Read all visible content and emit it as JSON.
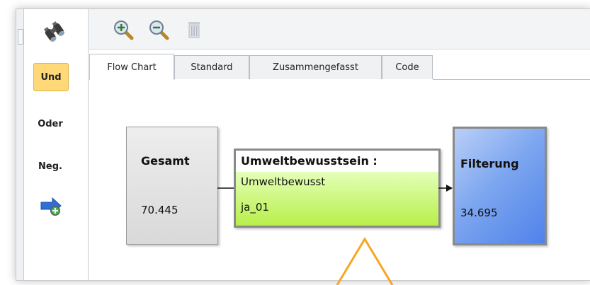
{
  "sidebar": {
    "buttons": [
      {
        "label": "Und",
        "active": true
      },
      {
        "label": "Oder"
      },
      {
        "label": "Neg."
      }
    ],
    "icons": [
      "binoculars-icon",
      "add-arrow-icon"
    ]
  },
  "toolbar": {
    "icons": [
      "zoom-in-icon",
      "zoom-out-icon",
      "trash-icon"
    ]
  },
  "tabs": [
    {
      "label": "Flow Chart",
      "active": true
    },
    {
      "label": "Standard"
    },
    {
      "label": "Zusammengefasst"
    },
    {
      "label": "Code"
    }
  ],
  "flow": {
    "gesamt": {
      "title": "Gesamt",
      "value": "70.445"
    },
    "umwelt": {
      "title": "Umweltbewusstsein :",
      "line1": "Umweltbewusst",
      "line2": "ja_01"
    },
    "filter": {
      "title": "Filterung",
      "value": "34.695"
    }
  },
  "colors": {
    "active_button": "#ffd978",
    "condition_fill": "#b8ef4a",
    "result_fill": "#4f82ea",
    "annotation": "#f5a623"
  }
}
